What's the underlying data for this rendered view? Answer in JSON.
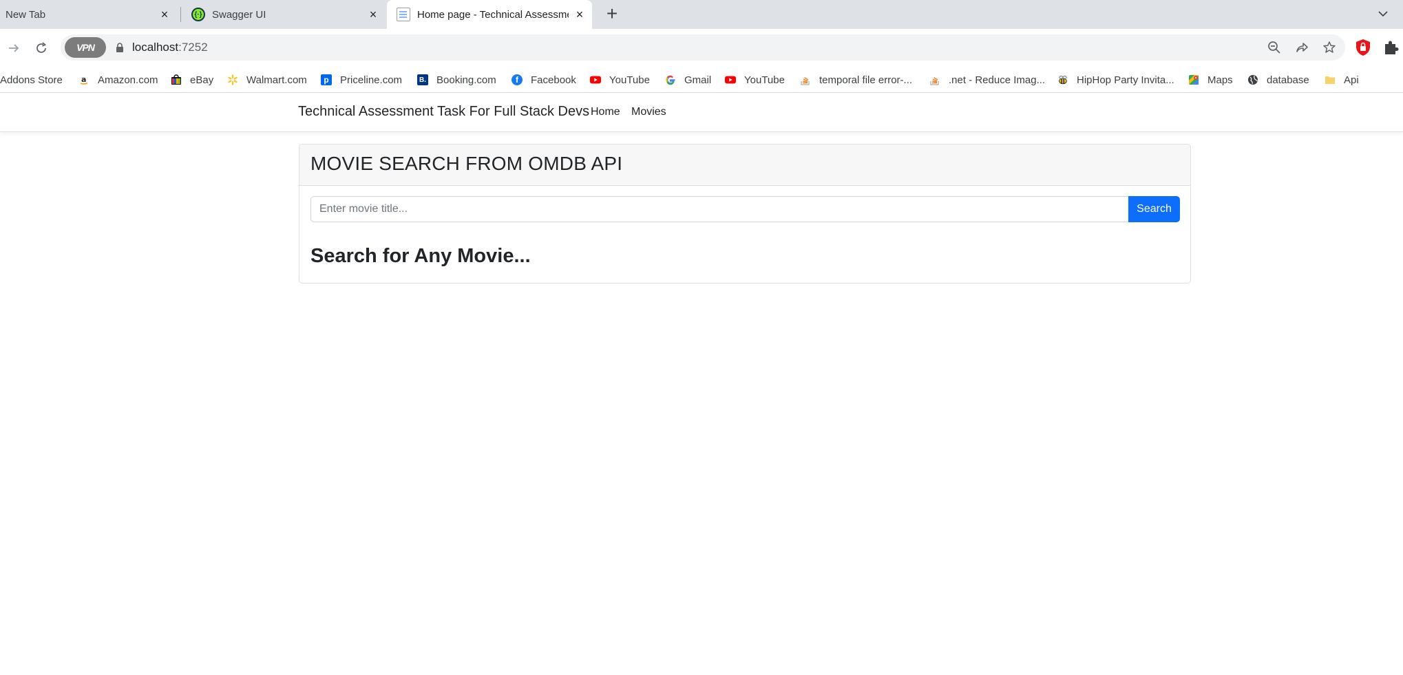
{
  "browser": {
    "tabs": [
      {
        "title": "New Tab",
        "close": "×"
      },
      {
        "title": "Swagger UI",
        "close": "×"
      },
      {
        "title": "Home page - Technical Assessment Task For Full Stack Devs",
        "close": "×"
      }
    ],
    "new_tab": "+",
    "tab_search": "⌄",
    "address": {
      "host": "localhost",
      "port": ":7252",
      "vpn_label": "VPN"
    },
    "bookmarks": [
      "Addons Store",
      "Amazon.com",
      "eBay",
      "Walmart.com",
      "Priceline.com",
      "Booking.com",
      "Facebook",
      "YouTube",
      "Gmail",
      "YouTube",
      "temporal file error-...",
      ".net - Reduce Imag...",
      "HipHop Party Invita...",
      "Maps",
      "database",
      "Api"
    ],
    "bookmark_icon_letters": {
      "priceline": "p",
      "booking": "B.",
      "facebook": "f",
      "gmail": "G"
    },
    "accent_colors": {
      "tab_strip": "#dee1e6",
      "youtube": "#ff0000",
      "primary_button": "#0d6efd"
    }
  },
  "site": {
    "brand": "Technical Assessment Task For Full Stack Devs",
    "nav": [
      "Home",
      "Movies"
    ]
  },
  "card": {
    "title": "MOVIE SEARCH FROM OMDB API",
    "search_placeholder": "Enter movie title...",
    "search_button": "Search",
    "result_heading": "Search for Any Movie..."
  }
}
